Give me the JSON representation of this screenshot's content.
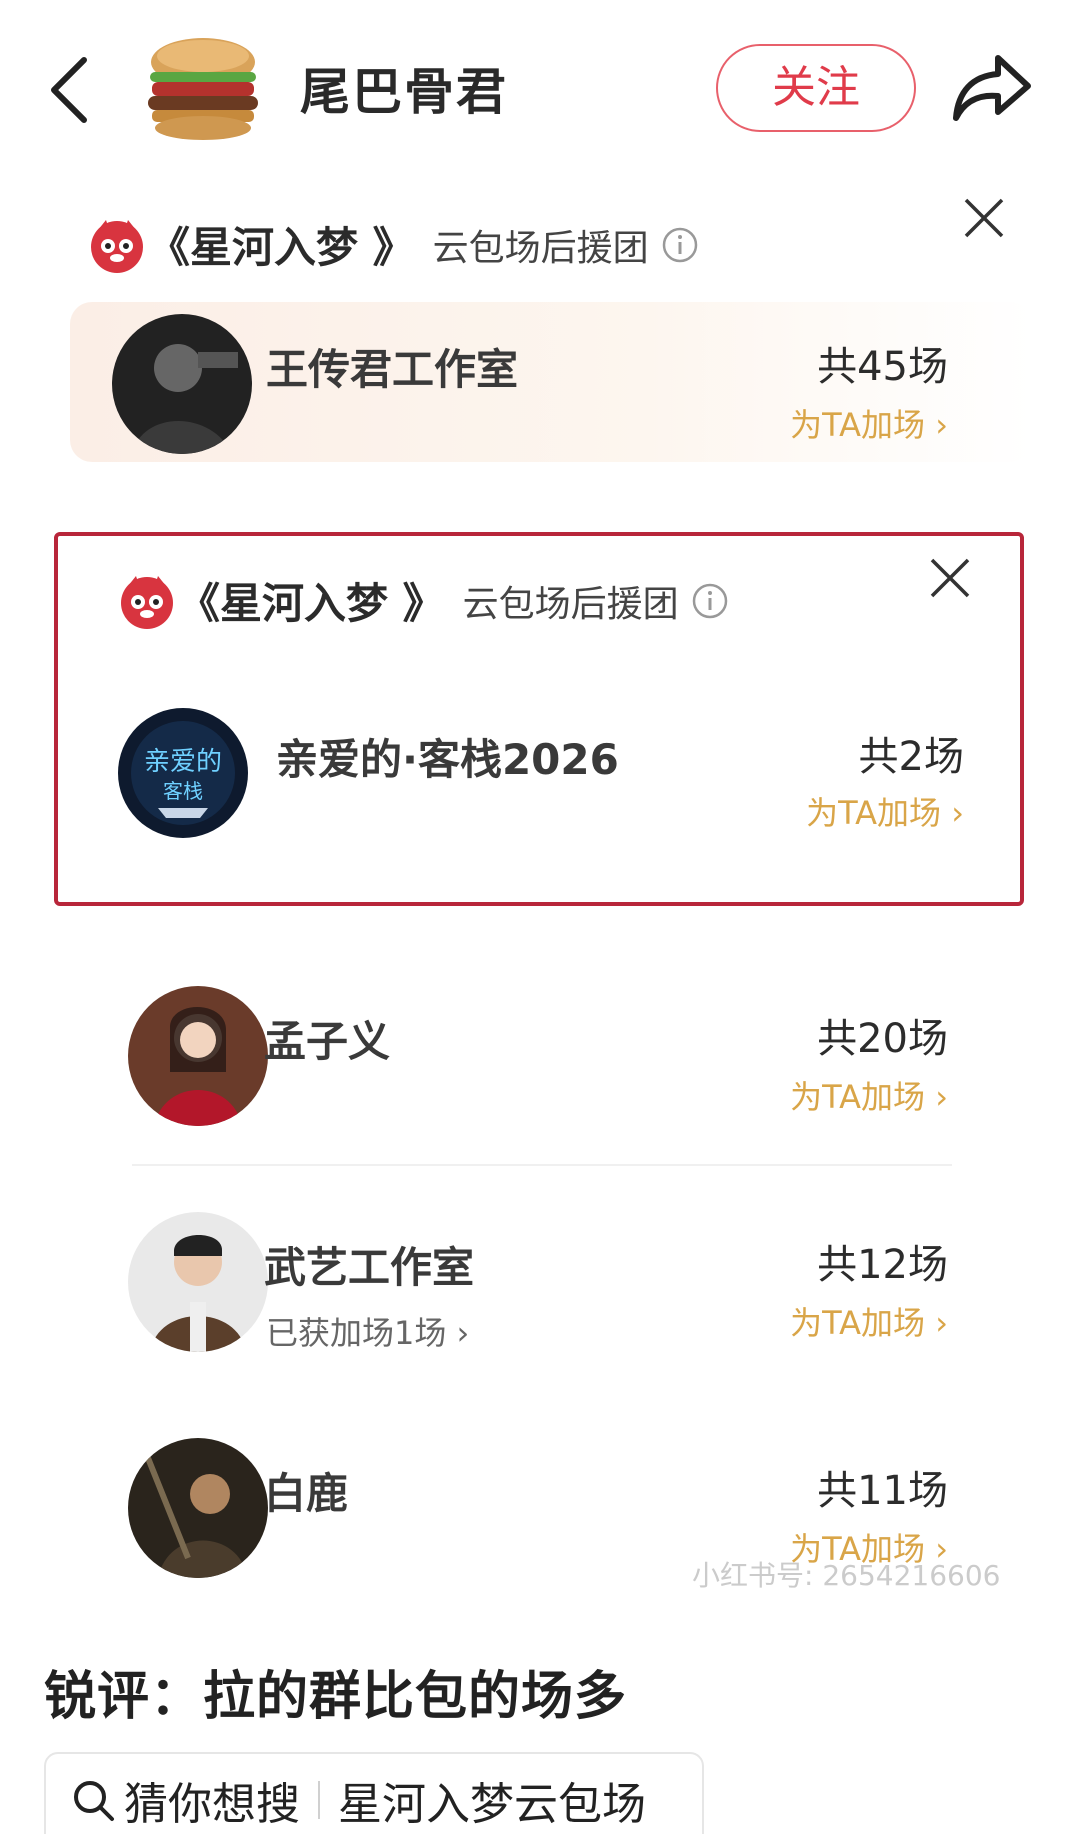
{
  "header": {
    "username": "尾巴骨君",
    "follow_label": "关注"
  },
  "cards": {
    "title": "《星河入梦 》",
    "subtitle": "云包场后援团"
  },
  "rows": [
    {
      "name": "王传君工作室",
      "count": "共45场",
      "boost": "为TA加场 ›",
      "subnote": ""
    },
    {
      "name": "亲爱的·客栈2026",
      "count": "共2场",
      "boost": "为TA加场 ›",
      "subnote": ""
    },
    {
      "name": "孟子义",
      "count": "共20场",
      "boost": "为TA加场 ›",
      "subnote": ""
    },
    {
      "name": "武艺工作室",
      "count": "共12场",
      "boost": "为TA加场 ›",
      "subnote": "已获加场1场 ›"
    },
    {
      "name": "白鹿",
      "count": "共11场",
      "boost": "为TA加场 ›",
      "subnote": ""
    }
  ],
  "watermark": "小红书号: 2654216606",
  "comment": "锐评：拉的群比包的场多",
  "search": {
    "prefix": "猜你想搜",
    "query": "星河入梦云包场"
  },
  "colors": {
    "accent_red": "#e03b4a",
    "highlight_border": "#b8263a",
    "boost_gold": "#d9a548"
  }
}
